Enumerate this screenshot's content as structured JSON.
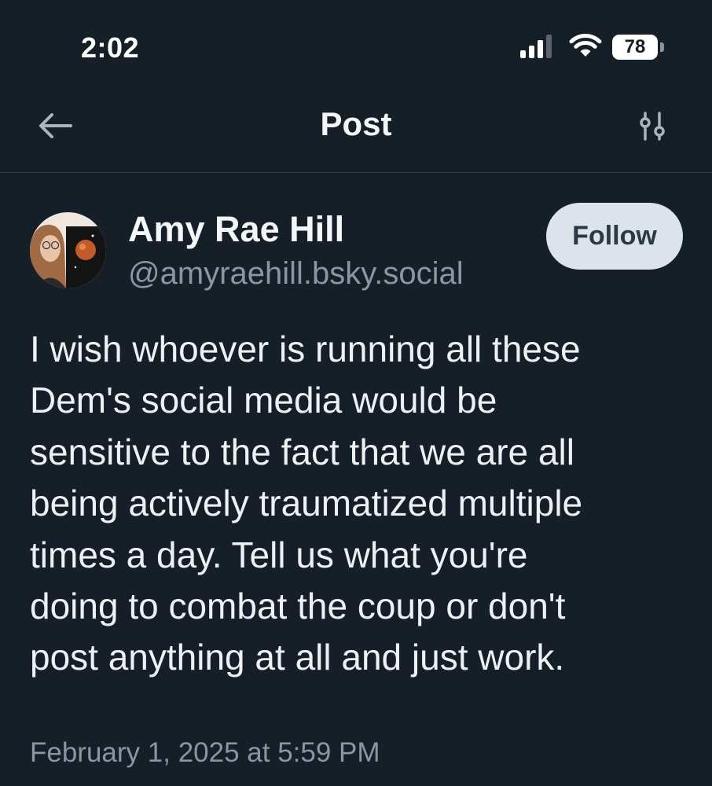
{
  "status_bar": {
    "time": "2:02",
    "battery_level": "78",
    "signal_icon": "cellular-signal-icon",
    "wifi_icon": "wifi-icon"
  },
  "header": {
    "title": "Post",
    "back_icon": "arrow-left-icon",
    "options_icon": "sliders-icon"
  },
  "post": {
    "author": {
      "display_name": "Amy Rae Hill",
      "handle": "@amyraehill.bsky.social"
    },
    "follow_label": "Follow",
    "text_lines": [
      "I wish whoever is running all these",
      "Dem's social media would be",
      "sensitive to the fact that we are all",
      "being actively traumatized multiple",
      "times a day. Tell us what you're",
      "doing to combat the coup or don't",
      "post anything at all and just work."
    ],
    "timestamp": "February 1, 2025 at 5:59 PM"
  },
  "colors": {
    "background": "#161e27",
    "text": "#eef1f4",
    "muted_text": "#8a96a3",
    "follow_button_bg": "#dde3ea",
    "divider": "#2e3945"
  }
}
